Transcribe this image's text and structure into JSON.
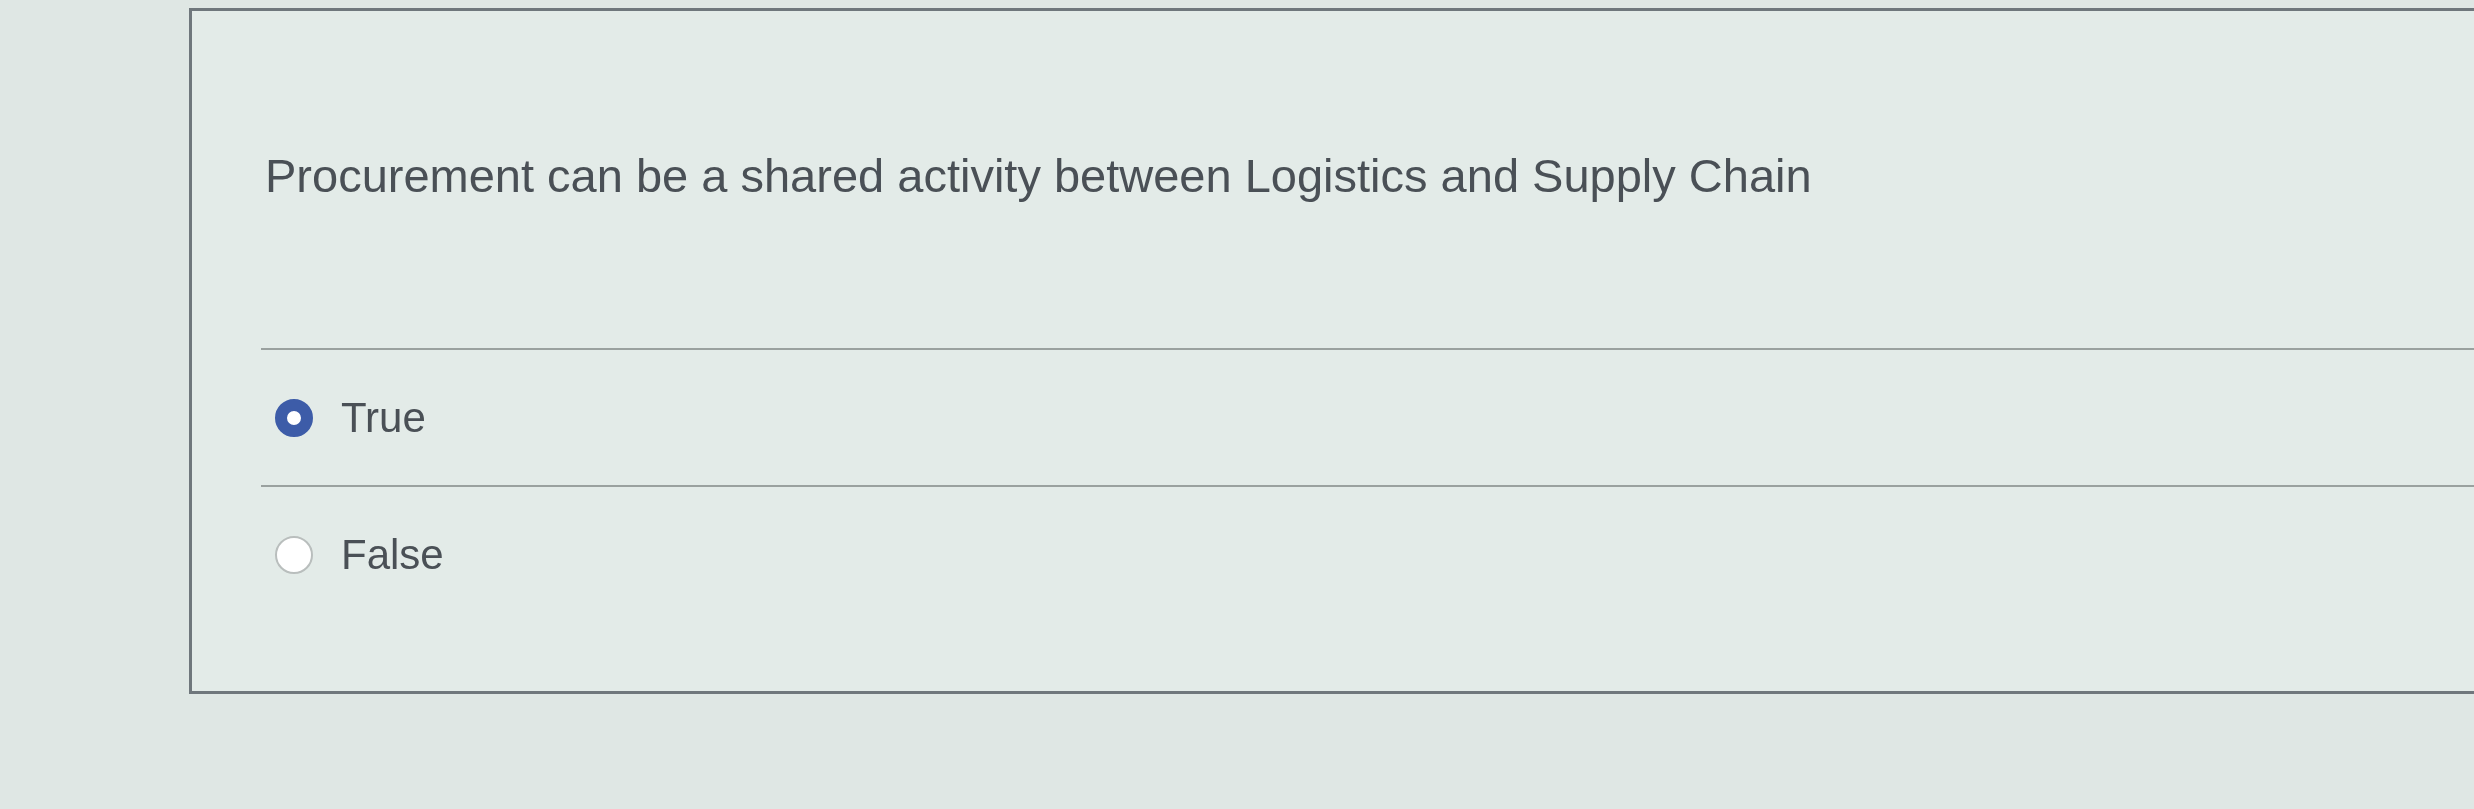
{
  "question": {
    "text": "Procurement can be a shared activity between Logistics and Supply Chain"
  },
  "options": [
    {
      "label": "True",
      "selected": true
    },
    {
      "label": "False",
      "selected": false
    }
  ]
}
